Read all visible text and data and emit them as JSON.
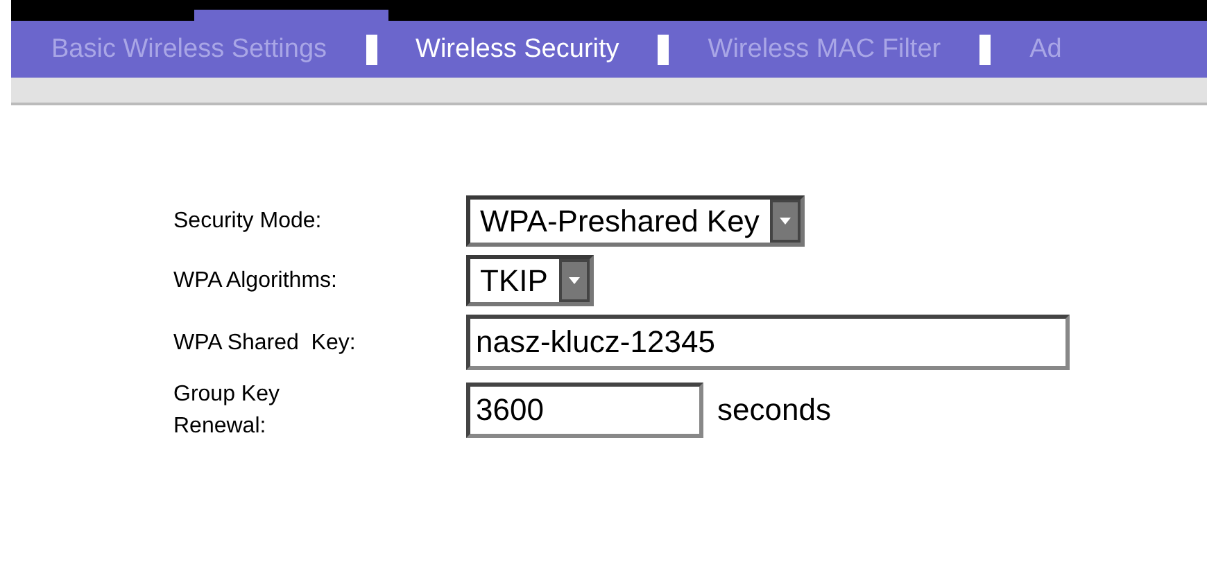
{
  "tabs": [
    {
      "label": "Basic Wireless Settings",
      "selected": false
    },
    {
      "label": "Wireless Security",
      "selected": true
    },
    {
      "label": "Wireless MAC Filter",
      "selected": false
    },
    {
      "label": "Ad",
      "selected": false
    }
  ],
  "fields": [
    {
      "kind": "select",
      "label": "Security Mode:",
      "value": "WPA-Preshared Key"
    },
    {
      "kind": "select",
      "label": "WPA Algorithms:",
      "value": "TKIP"
    },
    {
      "kind": "text",
      "label": "WPA Shared  Key:",
      "value": "nasz-klucz-12345"
    },
    {
      "kind": "text",
      "label": "Group Key Renewal:",
      "value": "3600",
      "suffix": "seconds"
    }
  ]
}
